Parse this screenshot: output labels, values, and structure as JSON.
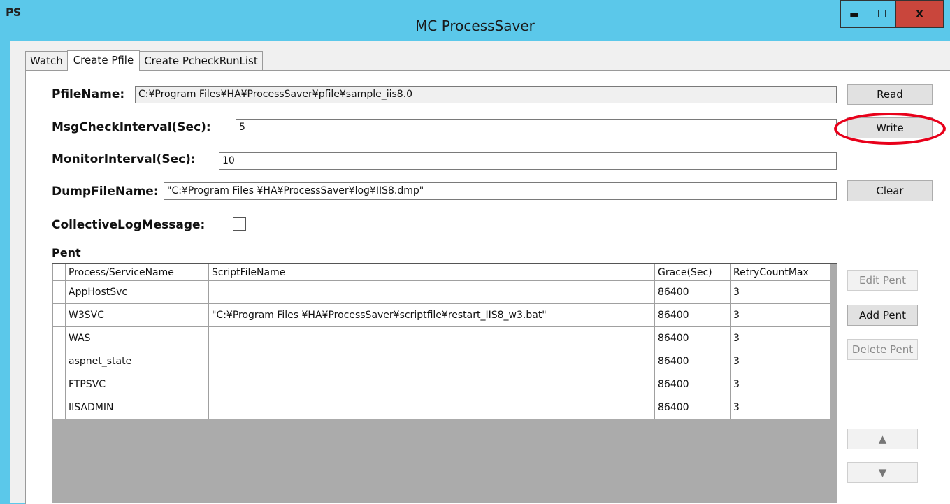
{
  "window": {
    "icon_text": "PS",
    "title": "MC ProcessSaver",
    "minimize_glyph": "▬",
    "maximize_glyph": "☐",
    "close_glyph": "X"
  },
  "tabs": [
    {
      "label": "Watch"
    },
    {
      "label": "Create Pfile"
    },
    {
      "label": "Create PcheckRunList"
    }
  ],
  "form": {
    "pfile_label": "PfileName:",
    "pfile_value": "C:¥Program Files¥HA¥ProcessSaver¥pfile¥sample_iis8.0",
    "msg_label": "MsgCheckInterval(Sec):",
    "msg_value": "5",
    "monitor_label": "MonitorInterval(Sec):",
    "monitor_value": "10",
    "dump_label": "DumpFileName:",
    "dump_value": "\"C:¥Program Files ¥HA¥ProcessSaver¥log¥IIS8.dmp\"",
    "collective_label": "CollectiveLogMessage:",
    "collective_checked": false
  },
  "buttons": {
    "read": "Read",
    "write": "Write",
    "clear": "Clear",
    "edit_pent": "Edit Pent",
    "add_pent": "Add Pent",
    "delete_pent": "Delete Pent",
    "up_glyph": "▲",
    "down_glyph": "▼"
  },
  "pent": {
    "label": "Pent",
    "columns": [
      "Process/ServiceName",
      "ScriptFileName",
      "Grace(Sec)",
      "RetryCountMax"
    ],
    "rows": [
      [
        "AppHostSvc",
        "",
        "86400",
        "3"
      ],
      [
        "W3SVC",
        "\"C:¥Program Files ¥HA¥ProcessSaver¥scriptfile¥restart_IIS8_w3.bat\"",
        "86400",
        "3"
      ],
      [
        "WAS",
        "",
        "86400",
        "3"
      ],
      [
        "aspnet_state",
        "",
        "86400",
        "3"
      ],
      [
        "FTPSVC",
        "",
        "86400",
        "3"
      ],
      [
        "IISADMIN",
        "",
        "86400",
        "3"
      ]
    ]
  },
  "colors": {
    "titlebar": "#5bc8ea",
    "close": "#c9463c",
    "highlight_ring": "#e8001a"
  }
}
